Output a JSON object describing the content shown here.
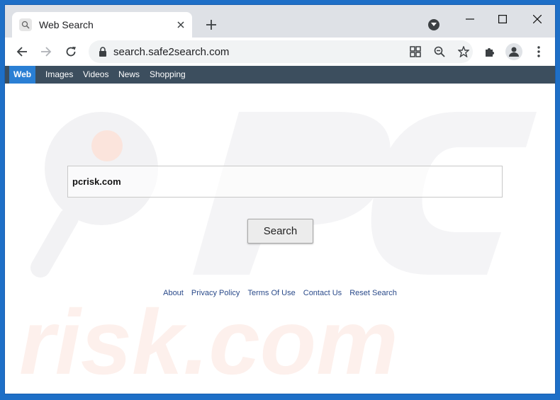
{
  "browser": {
    "tab_title": "Web Search",
    "url": "search.safe2search.com",
    "icons": {
      "tab_favicon": "search-icon",
      "tab_close": "close-icon",
      "new_tab": "plus-icon",
      "tab_search": "chevron-down-icon",
      "minimize": "minimize-icon",
      "maximize": "maximize-icon",
      "close_window": "close-icon",
      "back": "arrow-left-icon",
      "forward": "arrow-right-icon",
      "reload": "reload-icon",
      "lock": "lock-icon",
      "install_app": "apps-icon",
      "zoom": "zoom-out-icon",
      "bookmark": "star-icon",
      "extensions": "puzzle-icon",
      "profile": "avatar-icon",
      "menu": "kebab-menu-icon"
    }
  },
  "nav": {
    "items": [
      {
        "label": "Web",
        "active": true
      },
      {
        "label": "Images",
        "active": false
      },
      {
        "label": "Videos",
        "active": false
      },
      {
        "label": "News",
        "active": false
      },
      {
        "label": "Shopping",
        "active": false
      }
    ]
  },
  "search": {
    "value": "pcrisk.com",
    "button_label": "Search"
  },
  "footer": {
    "links": [
      "About",
      "Privacy Policy",
      "Terms Of Use",
      "Contact Us",
      "Reset Search"
    ]
  },
  "watermark": {
    "text": "risk.com",
    "logo": "PC"
  },
  "colors": {
    "nav_bar": "#3c4e5e",
    "nav_active": "#2a7fd4",
    "link": "#2a4a8a"
  }
}
